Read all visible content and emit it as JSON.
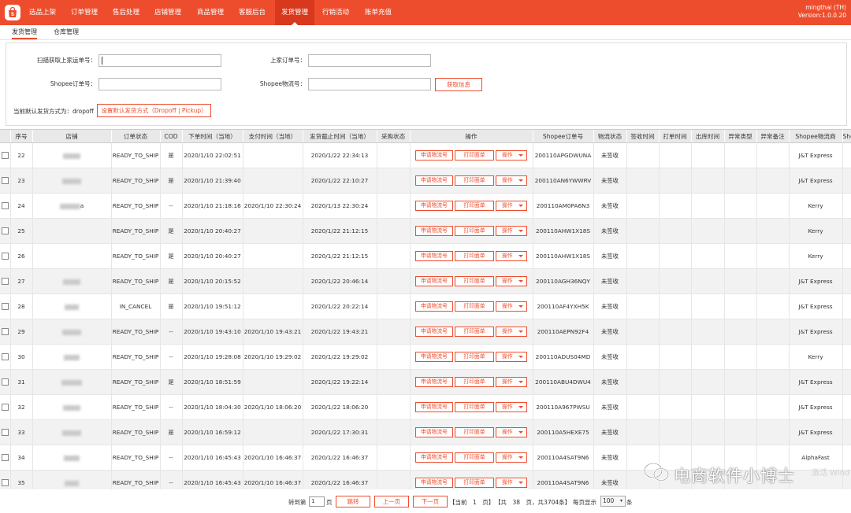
{
  "nav": {
    "items": [
      "选品上架",
      "订单管理",
      "售后处理",
      "店铺管理",
      "商品管理",
      "客服后台",
      "发货管理",
      "行销活动",
      "账单充值"
    ],
    "active": "发货管理",
    "user": "mingthai (TH)",
    "version": "Version:1.0.0.20"
  },
  "subtabs": [
    "发货管理",
    "仓库管理"
  ],
  "filter": {
    "scan_label": "扫描获取上家运单号：",
    "supplier_order_label": "上家订单号：",
    "shopee_order_label": "Shopee订单号：",
    "shopee_tracking_label": "Shopee物流号：",
    "fetch_button": "获取信息",
    "default_method_label": "当前默认发货方式为：dropoff",
    "set_default_button": "设置默认发货方式（Dropoff | Pickup）"
  },
  "table": {
    "headers": [
      "序号",
      "店铺",
      "订单状态",
      "COD",
      "下单时间（当地）",
      "支付时间（当地）",
      "发货截止时间（当地）",
      "采购状态",
      "操作",
      "Shopee订单号",
      "物流状态",
      "签收时间",
      "打单时间",
      "出库时间",
      "异常类型",
      "异常备注",
      "Shopee物流商",
      "Sho"
    ],
    "button_apply": "申请物流号",
    "button_print": "打印面单",
    "button_more": "操作",
    "rows": [
      {
        "no": "22",
        "status": "READY_TO_SHIP",
        "cod": "是",
        "order_time": "2020/1/10 22:02:51",
        "pay_time": "",
        "deadline": "2020/1/22 22:34:13",
        "shopee_no": "200110APGDWUNA",
        "logistics": "未签收",
        "carrier": "J&T Express"
      },
      {
        "no": "23",
        "status": "READY_TO_SHIP",
        "cod": "是",
        "order_time": "2020/1/10 21:39:40",
        "pay_time": "",
        "deadline": "2020/1/22 22:10:27",
        "shopee_no": "200110AN6YWWRV",
        "logistics": "未签收",
        "carrier": "J&T Express"
      },
      {
        "no": "24",
        "status": "READY_TO_SHIP",
        "cod": "--",
        "order_time": "2020/1/10 21:18:16",
        "pay_time": "2020/1/10 22:30:24",
        "deadline": "2020/1/13 22:30:24",
        "shopee_no": "200110AM0PA6N3",
        "logistics": "未签收",
        "carrier": "Kerry",
        "shop_suffix": "a"
      },
      {
        "no": "25",
        "status": "READY_TO_SHIP",
        "cod": "是",
        "order_time": "2020/1/10 20:40:27",
        "pay_time": "",
        "deadline": "2020/1/22 21:12:15",
        "shopee_no": "200110AHW1X18S",
        "logistics": "未签收",
        "carrier": "Kerry"
      },
      {
        "no": "26",
        "status": "READY_TO_SHIP",
        "cod": "是",
        "order_time": "2020/1/10 20:40:27",
        "pay_time": "",
        "deadline": "2020/1/22 21:12:15",
        "shopee_no": "200110AHW1X18S",
        "logistics": "未签收",
        "carrier": "Kerry"
      },
      {
        "no": "27",
        "status": "READY_TO_SHIP",
        "cod": "是",
        "order_time": "2020/1/10 20:15:52",
        "pay_time": "",
        "deadline": "2020/1/22 20:46:14",
        "shopee_no": "200110AGH36NQY",
        "logistics": "未签收",
        "carrier": "J&T Express"
      },
      {
        "no": "28",
        "status": "IN_CANCEL",
        "cod": "是",
        "order_time": "2020/1/10 19:51:12",
        "pay_time": "",
        "deadline": "2020/1/22 20:22:14",
        "shopee_no": "200110AF4YXH5K",
        "logistics": "未签收",
        "carrier": "J&T Express"
      },
      {
        "no": "29",
        "status": "READY_TO_SHIP",
        "cod": "--",
        "order_time": "2020/1/10 19:43:10",
        "pay_time": "2020/1/10 19:43:21",
        "deadline": "2020/1/22 19:43:21",
        "shopee_no": "200110AEPN92F4",
        "logistics": "未签收",
        "carrier": "J&T Express"
      },
      {
        "no": "30",
        "status": "READY_TO_SHIP",
        "cod": "--",
        "order_time": "2020/1/10 19:28:08",
        "pay_time": "2020/1/10 19:29:02",
        "deadline": "2020/1/22 19:29:02",
        "shopee_no": "200110ADUS04MD",
        "logistics": "未签收",
        "carrier": "Kerry"
      },
      {
        "no": "31",
        "status": "READY_TO_SHIP",
        "cod": "是",
        "order_time": "2020/1/10 18:51:59",
        "pay_time": "",
        "deadline": "2020/1/22 19:22:14",
        "shopee_no": "200110ABU4DWU4",
        "logistics": "未签收",
        "carrier": "J&T Express"
      },
      {
        "no": "32",
        "status": "READY_TO_SHIP",
        "cod": "--",
        "order_time": "2020/1/10 18:04:30",
        "pay_time": "2020/1/10 18:06:20",
        "deadline": "2020/1/22 18:06:20",
        "shopee_no": "200110A967PWSU",
        "logistics": "未签收",
        "carrier": "J&T Express"
      },
      {
        "no": "33",
        "status": "READY_TO_SHIP",
        "cod": "是",
        "order_time": "2020/1/10 16:59:12",
        "pay_time": "",
        "deadline": "2020/1/22 17:30:31",
        "shopee_no": "200110A5HEXE75",
        "logistics": "未签收",
        "carrier": "J&T Express"
      },
      {
        "no": "34",
        "status": "READY_TO_SHIP",
        "cod": "--",
        "order_time": "2020/1/10 16:45:43",
        "pay_time": "2020/1/10 16:46:37",
        "deadline": "2020/1/22 16:46:37",
        "shopee_no": "200110A4SAT9N6",
        "logistics": "未签收",
        "carrier": "AlphaFast"
      },
      {
        "no": "35",
        "status": "READY_TO_SHIP",
        "cod": "--",
        "order_time": "2020/1/10 16:45:43",
        "pay_time": "2020/1/10 16:46:37",
        "deadline": "2020/1/22 16:46:37",
        "shopee_no": "200110A4SAT9N6",
        "logistics": "未签收",
        "carrier": ""
      }
    ]
  },
  "pager": {
    "goto_label": "转到第",
    "page_value": "1",
    "page_unit": "页",
    "jump_button": "跳转",
    "prev_button": "上一页",
    "next_button": "下一页",
    "current": "【当前　1　页】",
    "total": "【共　38　页，共3704条】",
    "per_page_label": "每页显示",
    "per_page_value": "100",
    "per_page_unit": "条"
  },
  "watermark": {
    "text": "电商软件小博士",
    "icon": "wechat-icon"
  },
  "os_overlay": "激活 Wind",
  "colors": {
    "brand": "#ee4d2d"
  }
}
